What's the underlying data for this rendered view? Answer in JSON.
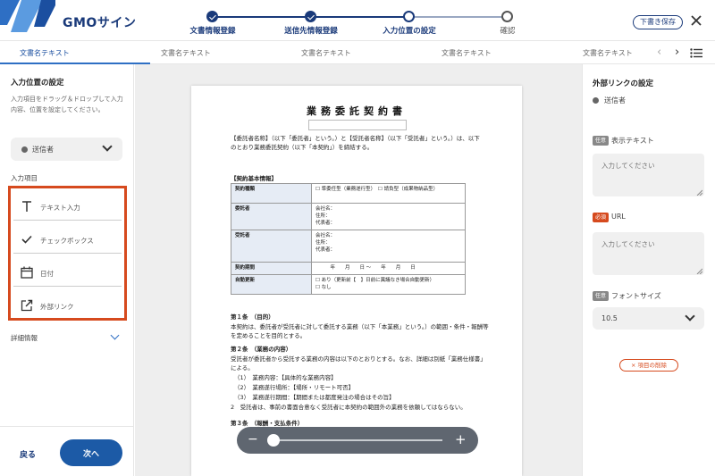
{
  "header": {
    "logo_text": "GMOサイン",
    "save_draft_label": "下書き保存",
    "steps": [
      {
        "label": "文書情報登録",
        "state": "done"
      },
      {
        "label": "送信先情報登録",
        "state": "done"
      },
      {
        "label": "入力位置の設定",
        "state": "current"
      },
      {
        "label": "確認",
        "state": "todo"
      }
    ]
  },
  "doc_tabs": [
    "文書名テキスト",
    "文書名テキスト",
    "文書名テキスト",
    "文書名テキスト",
    "文書名テキスト"
  ],
  "left_panel": {
    "title": "入力位置の設定",
    "description": "入力項目をドラッグ＆ドロップして入力内容、位置を設定してください。",
    "sender_select": "送信者",
    "items_label": "入力項目",
    "items": [
      {
        "label": "テキスト入力",
        "icon": "text-icon"
      },
      {
        "label": "チェックボックス",
        "icon": "check-icon"
      },
      {
        "label": "日付",
        "icon": "calendar-icon"
      },
      {
        "label": "外部リンク",
        "icon": "external-link-icon"
      }
    ],
    "details_label": "詳細情報",
    "back_label": "戻る",
    "next_label": "次へ"
  },
  "document": {
    "title": "業務委託契約書",
    "intro": "【委託者名称】（以下「委託者」という。）と【受託者名称】（以下「受託者」という。）は、以下のとおり業務委託契約（以下「本契約」）を締結する。",
    "basic_info_heading": "【契約基本情報】",
    "table": [
      {
        "head": "契約種類",
        "value": "☐ 準委任型（業務遂行型）　☐ 請負型（成果物納品型）"
      },
      {
        "head": "委託者",
        "value": "会社名：\n住所：\n代表者："
      },
      {
        "head": "受託者",
        "value": "会社名：\n住所：\n代表者："
      },
      {
        "head": "契約期間",
        "value": "　　　年　　月　　日 〜　　年　　月　　日"
      },
      {
        "head": "自動更新",
        "value": "☐ あり（更新前【　】日前に異議なき場合自動更新）\n☐ なし"
      }
    ],
    "article1_heading": "第１条　（目的）",
    "article1_body": "本契約は、委託者が受託者に対して委託する業務（以下「本業務」という。）の範囲・条件・報酬等を定めることを目的とする。",
    "article2_heading": "第２条　（業務の内容）",
    "article2_body": "受託者が委託者から受託する業務の内容は以下のとおりとする。なお、詳細は別紙「業務仕様書」による。",
    "article2_items": [
      "（1）　業務内容：【具体的な業務内容】",
      "（2）　業務遂行場所：【場所・リモート可否】",
      "（3）　業務遂行期間：【期間または都度発注の場合はその旨】",
      "2　受託者は、事前の書面合意なく受託者に本契約の範囲外の業務を依頼してはならない。"
    ],
    "article3_heading": "第３条　（報酬・支払条件）"
  },
  "right_panel": {
    "title": "外部リンクの設定",
    "sender": "送信者",
    "optional_badge": "任意",
    "required_badge": "必須",
    "display_text_label": "表示テキスト",
    "display_text_placeholder": "入力してください",
    "url_label": "URL",
    "url_placeholder": "入力してください",
    "font_size_label": "フォントサイズ",
    "font_size_value": "10.5",
    "delete_label": "× 項目の削除"
  },
  "colors": {
    "brand": "#1a3a7a",
    "accent": "#1c5aa6",
    "highlight": "#d64a1e"
  }
}
